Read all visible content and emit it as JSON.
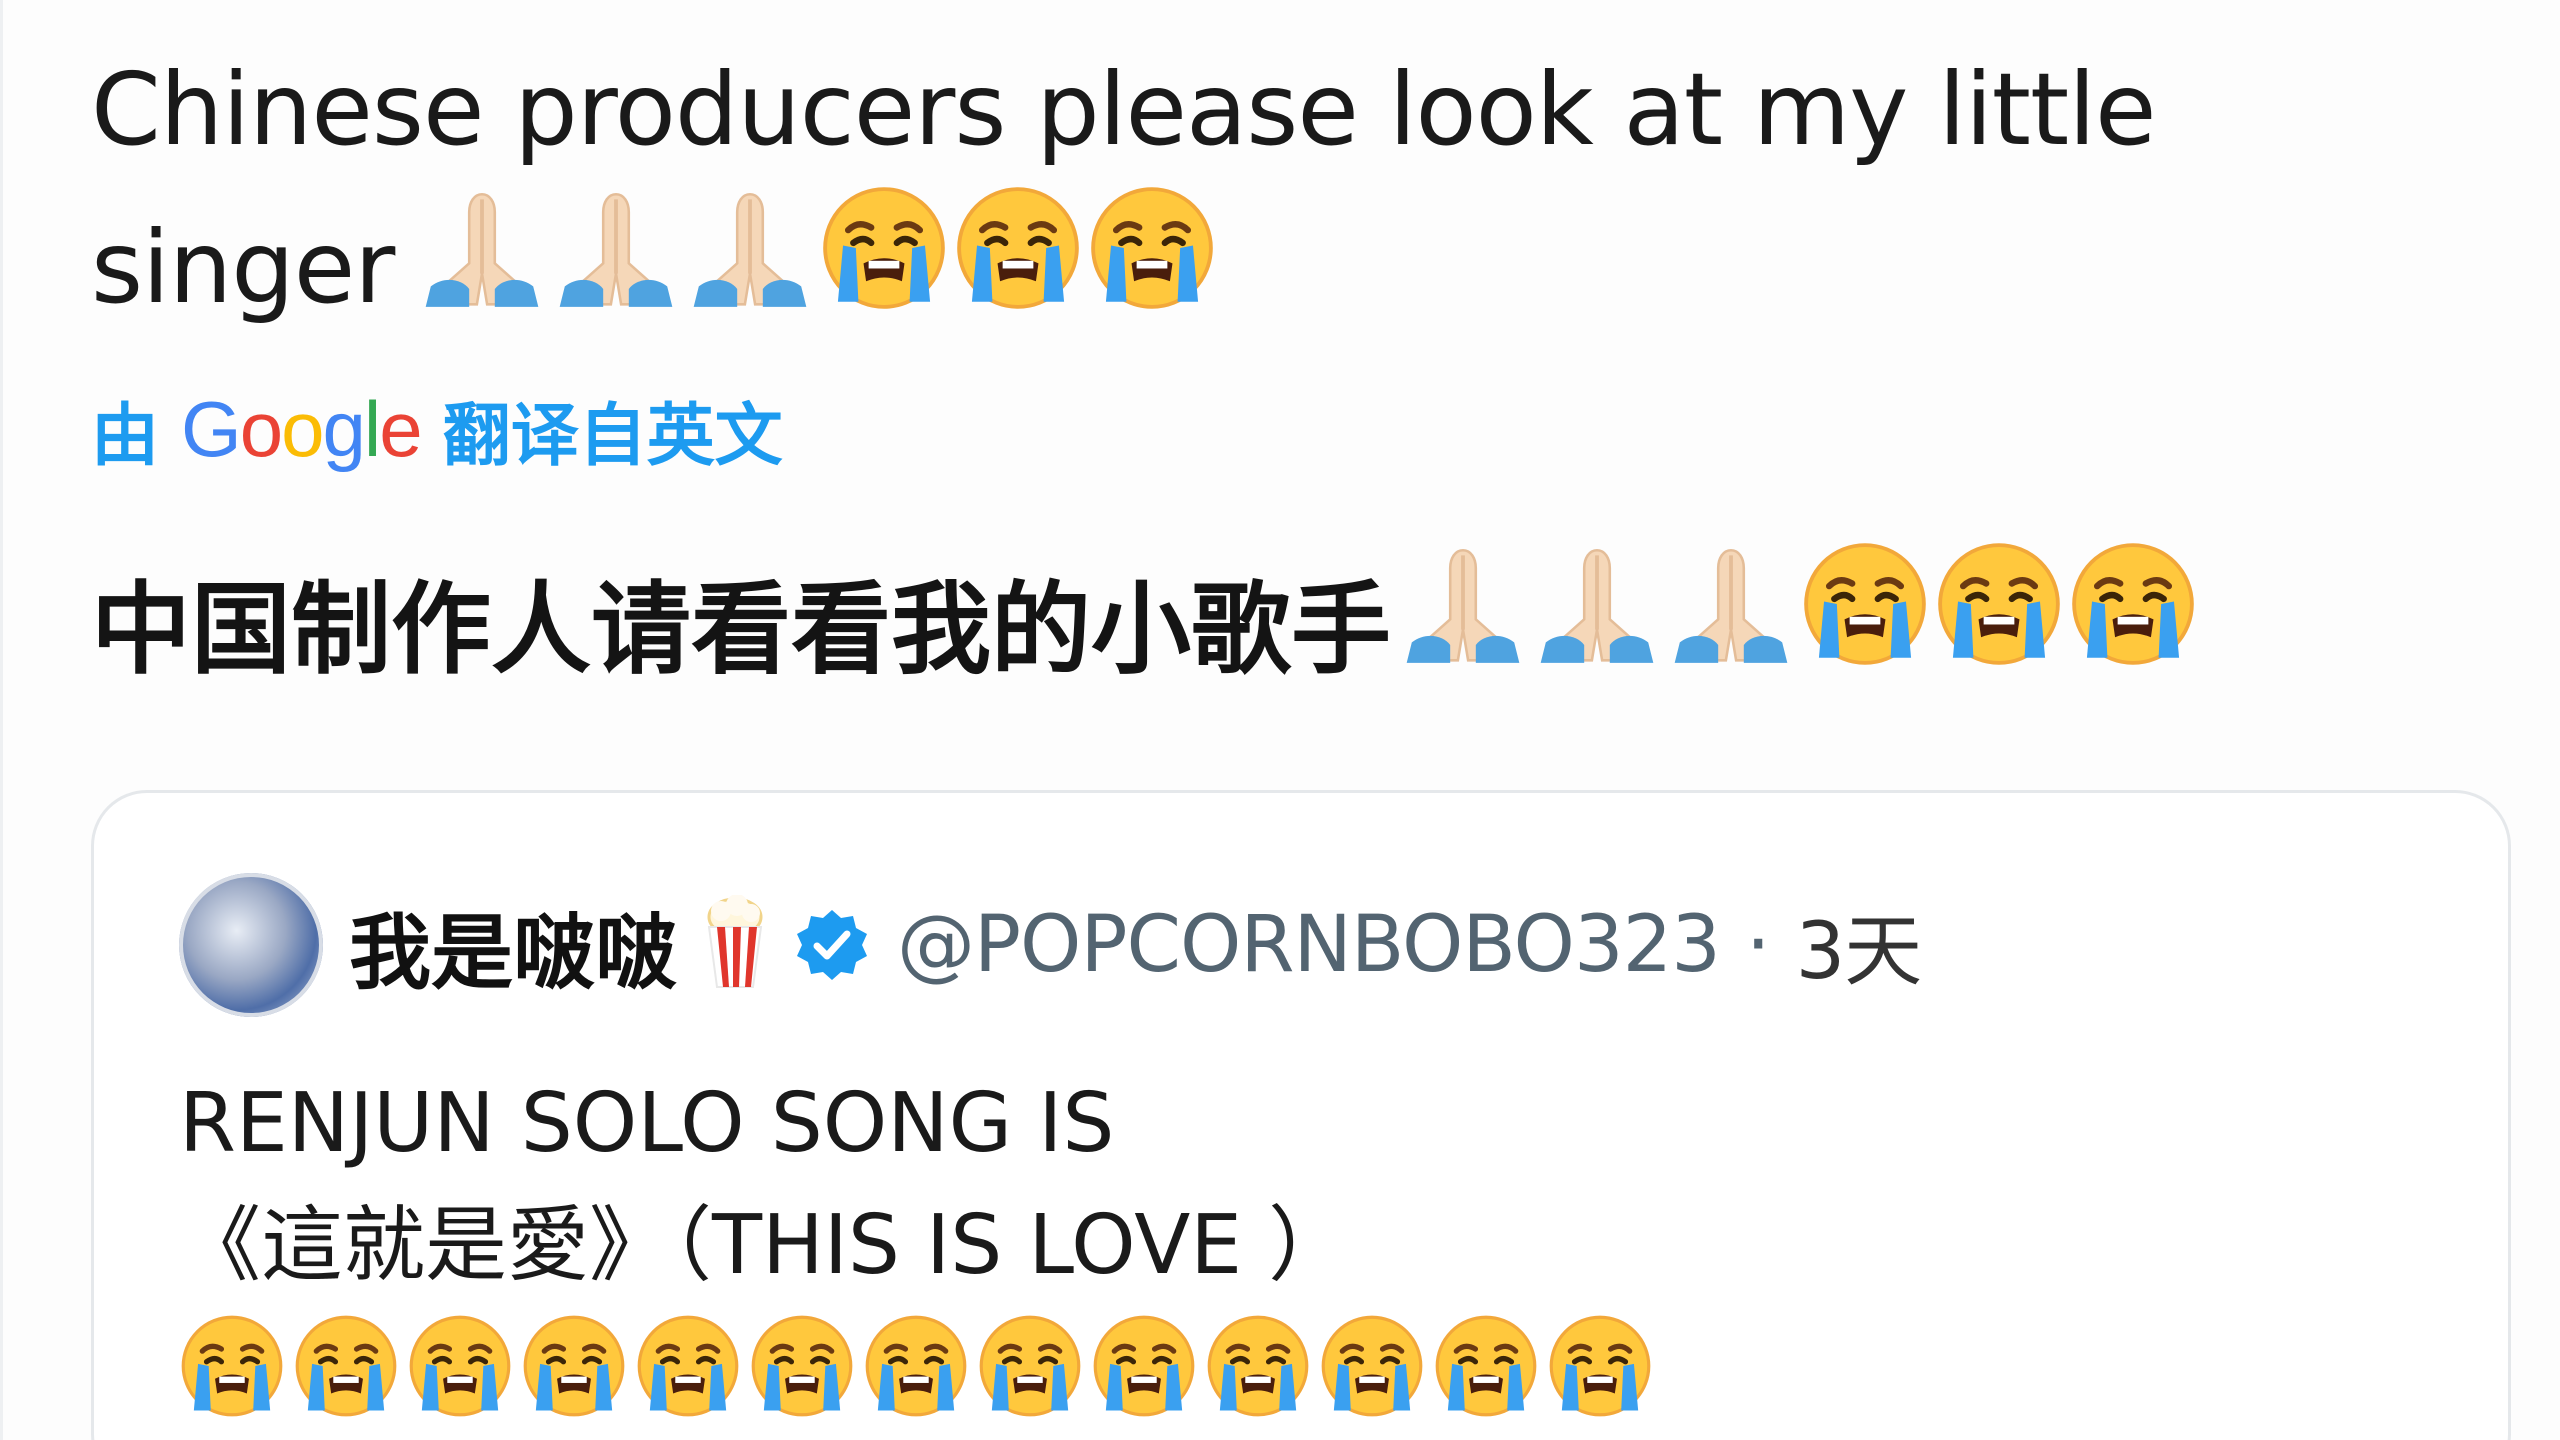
{
  "tweet": {
    "text_line1": "Chinese producers please look at my little",
    "text_line2": "singer",
    "emojis": [
      "folded-hands",
      "folded-hands",
      "folded-hands",
      "loudly-crying",
      "loudly-crying",
      "loudly-crying"
    ]
  },
  "translation": {
    "prefix": "由",
    "provider": "Google",
    "suffix": "翻译自英文",
    "translated_text": "中国制作人请看看我的小歌手",
    "color": "#1d9bf0"
  },
  "quote": {
    "display_name": "我是啵啵",
    "name_emoji": "popcorn",
    "handle": "@POPCORNBOBO323",
    "separator": "·",
    "time": "3天",
    "body_line1": "RENJUN SOLO SONG IS",
    "body_line2": "《這就是愛》（THIS IS LOVE ）",
    "emoji_count": 13,
    "verified_color": "#1d9bf0"
  }
}
